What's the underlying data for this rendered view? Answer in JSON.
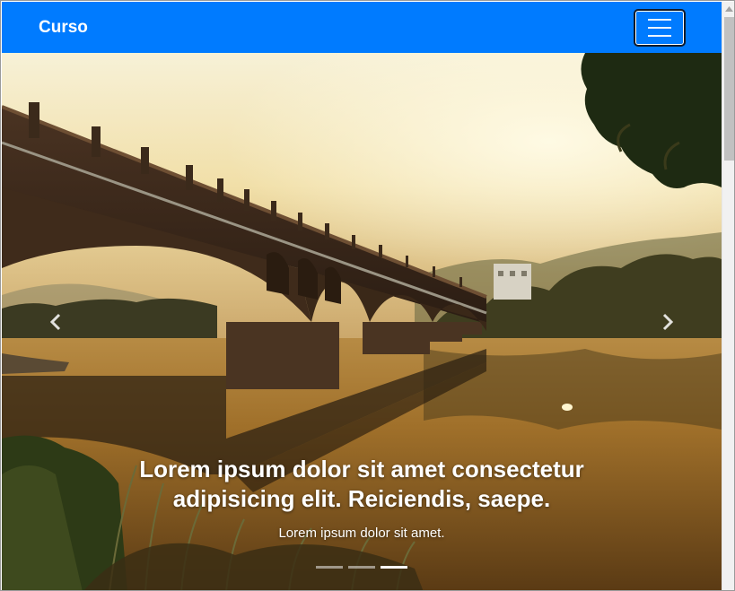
{
  "navbar": {
    "brand": "Curso",
    "toggler_icon": "hamburger-menu-icon",
    "background_color": "#007bff"
  },
  "carousel": {
    "image": "bridge-over-river-at-sunset",
    "prev_icon": "chevron-left-icon",
    "next_icon": "chevron-right-icon",
    "caption": {
      "title": "Lorem ipsum dolor sit amet consectetur adipisicing elit. Reiciendis, saepe.",
      "text": "Lorem ipsum dolor sit amet."
    },
    "indicators": {
      "count": 3,
      "active_index": 2
    }
  },
  "scrollbar": {
    "up_icon": "scroll-up-arrow-icon"
  }
}
